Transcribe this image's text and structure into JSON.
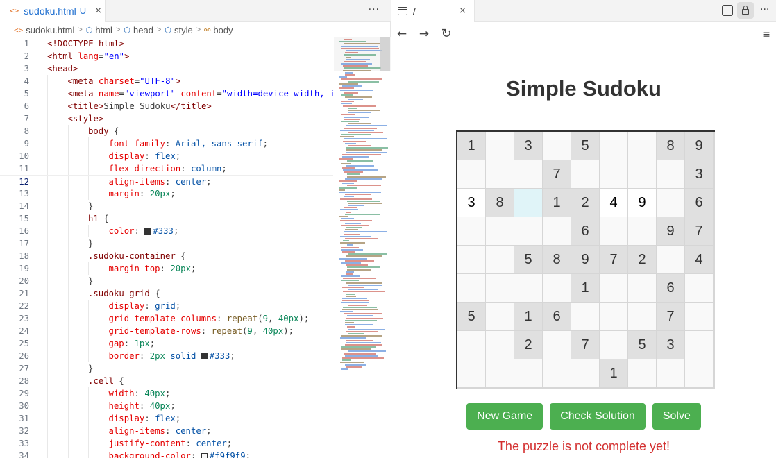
{
  "editor": {
    "tab": {
      "filename": "sudoku.html",
      "status": "U",
      "close": "×"
    },
    "more": "···",
    "breadcrumbs": [
      "sudoku.html",
      "html",
      "head",
      "style",
      "body"
    ],
    "current_line": 12,
    "lines": [
      [
        1,
        0,
        [
          [
            "t-tag",
            "<!DOCTYPE html>"
          ]
        ]
      ],
      [
        2,
        0,
        [
          [
            "t-tag",
            "<html "
          ],
          [
            "t-attr",
            "lang"
          ],
          [
            "t-punc",
            "="
          ],
          [
            "t-str",
            "\"en\""
          ],
          [
            "t-tag",
            ">"
          ]
        ]
      ],
      [
        3,
        0,
        [
          [
            "t-tag",
            "<head>"
          ]
        ]
      ],
      [
        4,
        1,
        [
          [
            "t-tag",
            "<meta "
          ],
          [
            "t-attr",
            "charset"
          ],
          [
            "t-punc",
            "="
          ],
          [
            "t-str",
            "\"UTF-8\""
          ],
          [
            "t-tag",
            ">"
          ]
        ]
      ],
      [
        5,
        1,
        [
          [
            "t-tag",
            "<meta "
          ],
          [
            "t-attr",
            "name"
          ],
          [
            "t-punc",
            "="
          ],
          [
            "t-str",
            "\"viewport\""
          ],
          [
            "t-text",
            " "
          ],
          [
            "t-attr",
            "content"
          ],
          [
            "t-punc",
            "="
          ],
          [
            "t-str",
            "\"width=device-width, ini"
          ]
        ]
      ],
      [
        6,
        1,
        [
          [
            "t-tag",
            "<title>"
          ],
          [
            "t-text",
            "Simple Sudoku"
          ],
          [
            "t-tag",
            "</title>"
          ]
        ]
      ],
      [
        7,
        1,
        [
          [
            "t-tag",
            "<style>"
          ]
        ]
      ],
      [
        8,
        2,
        [
          [
            "t-sel",
            "body"
          ],
          [
            "t-punc",
            " {"
          ]
        ]
      ],
      [
        9,
        3,
        [
          [
            "t-prop",
            "font-family"
          ],
          [
            "t-punc",
            ": "
          ],
          [
            "t-val",
            "Arial, sans-serif"
          ],
          [
            "t-punc",
            ";"
          ]
        ]
      ],
      [
        10,
        3,
        [
          [
            "t-prop",
            "display"
          ],
          [
            "t-punc",
            ": "
          ],
          [
            "t-val",
            "flex"
          ],
          [
            "t-punc",
            ";"
          ]
        ]
      ],
      [
        11,
        3,
        [
          [
            "t-prop",
            "flex-direction"
          ],
          [
            "t-punc",
            ": "
          ],
          [
            "t-val",
            "column"
          ],
          [
            "t-punc",
            ";"
          ]
        ]
      ],
      [
        12,
        3,
        [
          [
            "t-prop",
            "align-items"
          ],
          [
            "t-punc",
            ": "
          ],
          [
            "t-val",
            "center"
          ],
          [
            "t-punc",
            ";"
          ]
        ]
      ],
      [
        13,
        3,
        [
          [
            "t-prop",
            "margin"
          ],
          [
            "t-punc",
            ": "
          ],
          [
            "t-num",
            "20px"
          ],
          [
            "t-punc",
            ";"
          ]
        ]
      ],
      [
        14,
        2,
        [
          [
            "t-punc",
            "}"
          ]
        ]
      ],
      [
        15,
        2,
        [
          [
            "t-sel",
            "h1"
          ],
          [
            "t-punc",
            " {"
          ]
        ]
      ],
      [
        16,
        3,
        [
          [
            "t-prop",
            "color"
          ],
          [
            "t-punc",
            ": "
          ],
          [
            "swatch",
            "#333333"
          ],
          [
            "t-val",
            "#333"
          ],
          [
            "t-punc",
            ";"
          ]
        ]
      ],
      [
        17,
        2,
        [
          [
            "t-punc",
            "}"
          ]
        ]
      ],
      [
        18,
        2,
        [
          [
            "t-sel",
            ".sudoku-container"
          ],
          [
            "t-punc",
            " {"
          ]
        ]
      ],
      [
        19,
        3,
        [
          [
            "t-prop",
            "margin-top"
          ],
          [
            "t-punc",
            ": "
          ],
          [
            "t-num",
            "20px"
          ],
          [
            "t-punc",
            ";"
          ]
        ]
      ],
      [
        20,
        2,
        [
          [
            "t-punc",
            "}"
          ]
        ]
      ],
      [
        21,
        2,
        [
          [
            "t-sel",
            ".sudoku-grid"
          ],
          [
            "t-punc",
            " {"
          ]
        ]
      ],
      [
        22,
        3,
        [
          [
            "t-prop",
            "display"
          ],
          [
            "t-punc",
            ": "
          ],
          [
            "t-val",
            "grid"
          ],
          [
            "t-punc",
            ";"
          ]
        ]
      ],
      [
        23,
        3,
        [
          [
            "t-prop",
            "grid-template-columns"
          ],
          [
            "t-punc",
            ": "
          ],
          [
            "t-fn",
            "repeat"
          ],
          [
            "t-punc",
            "("
          ],
          [
            "t-num",
            "9"
          ],
          [
            "t-punc",
            ", "
          ],
          [
            "t-num",
            "40px"
          ],
          [
            "t-punc",
            ");"
          ]
        ]
      ],
      [
        24,
        3,
        [
          [
            "t-prop",
            "grid-template-rows"
          ],
          [
            "t-punc",
            ": "
          ],
          [
            "t-fn",
            "repeat"
          ],
          [
            "t-punc",
            "("
          ],
          [
            "t-num",
            "9"
          ],
          [
            "t-punc",
            ", "
          ],
          [
            "t-num",
            "40px"
          ],
          [
            "t-punc",
            ");"
          ]
        ]
      ],
      [
        25,
        3,
        [
          [
            "t-prop",
            "gap"
          ],
          [
            "t-punc",
            ": "
          ],
          [
            "t-num",
            "1px"
          ],
          [
            "t-punc",
            ";"
          ]
        ]
      ],
      [
        26,
        3,
        [
          [
            "t-prop",
            "border"
          ],
          [
            "t-punc",
            ": "
          ],
          [
            "t-num",
            "2px"
          ],
          [
            "t-val",
            " solid "
          ],
          [
            "swatch",
            "#333333"
          ],
          [
            "t-val",
            "#333"
          ],
          [
            "t-punc",
            ";"
          ]
        ]
      ],
      [
        27,
        2,
        [
          [
            "t-punc",
            "}"
          ]
        ]
      ],
      [
        28,
        2,
        [
          [
            "t-sel",
            ".cell"
          ],
          [
            "t-punc",
            " {"
          ]
        ]
      ],
      [
        29,
        3,
        [
          [
            "t-prop",
            "width"
          ],
          [
            "t-punc",
            ": "
          ],
          [
            "t-num",
            "40px"
          ],
          [
            "t-punc",
            ";"
          ]
        ]
      ],
      [
        30,
        3,
        [
          [
            "t-prop",
            "height"
          ],
          [
            "t-punc",
            ": "
          ],
          [
            "t-num",
            "40px"
          ],
          [
            "t-punc",
            ";"
          ]
        ]
      ],
      [
        31,
        3,
        [
          [
            "t-prop",
            "display"
          ],
          [
            "t-punc",
            ": "
          ],
          [
            "t-val",
            "flex"
          ],
          [
            "t-punc",
            ";"
          ]
        ]
      ],
      [
        32,
        3,
        [
          [
            "t-prop",
            "align-items"
          ],
          [
            "t-punc",
            ": "
          ],
          [
            "t-val",
            "center"
          ],
          [
            "t-punc",
            ";"
          ]
        ]
      ],
      [
        33,
        3,
        [
          [
            "t-prop",
            "justify-content"
          ],
          [
            "t-punc",
            ": "
          ],
          [
            "t-val",
            "center"
          ],
          [
            "t-punc",
            ";"
          ]
        ]
      ],
      [
        34,
        3,
        [
          [
            "t-prop",
            "background-color"
          ],
          [
            "t-punc",
            ": "
          ],
          [
            "swatch",
            "#f9f9f9"
          ],
          [
            "t-val",
            "#f9f9f9"
          ],
          [
            "t-punc",
            ";"
          ]
        ]
      ]
    ]
  },
  "preview": {
    "tab": {
      "title": "/",
      "close": "×"
    },
    "title": "Simple Sudoku",
    "grid": [
      [
        [
          "1",
          "g"
        ],
        [
          "",
          ""
        ],
        [
          "3",
          "g"
        ],
        [
          "",
          ""
        ],
        [
          "5",
          "g"
        ],
        [
          "",
          ""
        ],
        [
          "",
          ""
        ],
        [
          "8",
          "g"
        ],
        [
          "9",
          "g"
        ]
      ],
      [
        [
          "",
          ""
        ],
        [
          "",
          ""
        ],
        [
          "",
          ""
        ],
        [
          "7",
          "g"
        ],
        [
          "",
          ""
        ],
        [
          "",
          ""
        ],
        [
          "",
          ""
        ],
        [
          "",
          ""
        ],
        [
          "3",
          "g"
        ]
      ],
      [
        [
          "3",
          "u"
        ],
        [
          "8",
          "g"
        ],
        [
          "",
          "s"
        ],
        [
          "1",
          "g"
        ],
        [
          "2",
          "g"
        ],
        [
          "4",
          "u"
        ],
        [
          "9",
          "u"
        ],
        [
          "",
          ""
        ],
        [
          "6",
          "g"
        ]
      ],
      [
        [
          "",
          ""
        ],
        [
          "",
          ""
        ],
        [
          "",
          ""
        ],
        [
          "",
          ""
        ],
        [
          "6",
          "g"
        ],
        [
          "",
          ""
        ],
        [
          "",
          ""
        ],
        [
          "9",
          "g"
        ],
        [
          "7",
          "g"
        ]
      ],
      [
        [
          "",
          ""
        ],
        [
          "",
          ""
        ],
        [
          "5",
          "g"
        ],
        [
          "8",
          "g"
        ],
        [
          "9",
          "g"
        ],
        [
          "7",
          "g"
        ],
        [
          "2",
          "g"
        ],
        [
          "",
          ""
        ],
        [
          "4",
          "g"
        ]
      ],
      [
        [
          "",
          ""
        ],
        [
          "",
          ""
        ],
        [
          "",
          ""
        ],
        [
          "",
          ""
        ],
        [
          "1",
          "g"
        ],
        [
          "",
          ""
        ],
        [
          "",
          ""
        ],
        [
          "6",
          "g"
        ],
        [
          "",
          ""
        ]
      ],
      [
        [
          "5",
          "g"
        ],
        [
          "",
          ""
        ],
        [
          "1",
          "g"
        ],
        [
          "6",
          "g"
        ],
        [
          "",
          ""
        ],
        [
          "",
          ""
        ],
        [
          "",
          ""
        ],
        [
          "7",
          "g"
        ],
        [
          "",
          ""
        ]
      ],
      [
        [
          "",
          ""
        ],
        [
          "",
          ""
        ],
        [
          "2",
          "g"
        ],
        [
          "",
          ""
        ],
        [
          "7",
          "g"
        ],
        [
          "",
          ""
        ],
        [
          "5",
          "g"
        ],
        [
          "3",
          "g"
        ],
        [
          "",
          ""
        ]
      ],
      [
        [
          "",
          ""
        ],
        [
          "",
          ""
        ],
        [
          "",
          ""
        ],
        [
          "",
          ""
        ],
        [
          "",
          ""
        ],
        [
          "1",
          "g"
        ],
        [
          "",
          ""
        ],
        [
          "",
          ""
        ],
        [
          "",
          ""
        ]
      ]
    ],
    "buttons": {
      "new_game": "New Game",
      "check": "Check Solution",
      "solve": "Solve"
    },
    "status": "The puzzle is not complete yet!",
    "colors": {
      "button": "#4caf50",
      "status": "#d32f2f",
      "given_cell": "#e0e0e0",
      "selected_cell": "#e0f4f8"
    }
  },
  "icons": {
    "back": "arrow-left-icon",
    "forward": "arrow-right-icon",
    "reload": "reload-icon",
    "menu": "hamburger-menu-icon",
    "split": "split-editor-icon",
    "lock": "lock-icon"
  }
}
